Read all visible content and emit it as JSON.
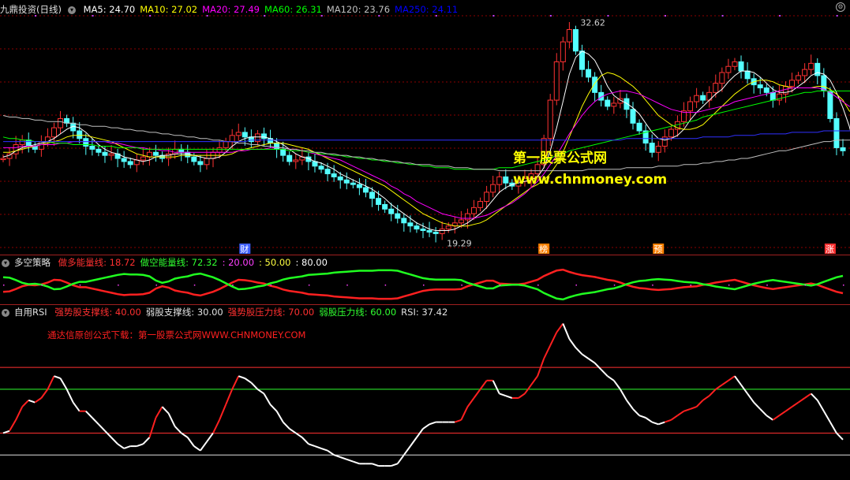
{
  "main": {
    "title": "九鼎投资(日线)",
    "ma": [
      {
        "label": "MA5: 24.70",
        "color": "#ffffff"
      },
      {
        "label": "MA10: 27.02",
        "color": "#ffff00"
      },
      {
        "label": "MA20: 27.49",
        "color": "#ff00ff"
      },
      {
        "label": "MA60: 26.31",
        "color": "#00ff00"
      },
      {
        "label": "MA120: 23.76",
        "color": "#c0c0c0"
      },
      {
        "label": "MA250: 24.11",
        "color": "#0000ff"
      }
    ],
    "high_label": "32.62",
    "low_label": "19.29",
    "watermark_cn": "第一股票公式网",
    "watermark_en": "www.chnmoney.com",
    "markers": [
      "财",
      "榜",
      "预",
      "涨"
    ]
  },
  "ind1": {
    "title": "多空策略",
    "labels": [
      {
        "text": "做多能量线: 18.72",
        "color": "#ff3030"
      },
      {
        "text": "做空能量线: 72.32",
        "color": "#30ff30"
      },
      {
        "text": ": 20.00",
        "color": "#ff40ff"
      },
      {
        "text": ": 50.00",
        "color": "#ffff40"
      },
      {
        "text": ": 80.00",
        "color": "#ffffff"
      }
    ]
  },
  "ind2": {
    "title": "自用RSI",
    "labels": [
      {
        "text": "强势股支撑线: 40.00",
        "color": "#ff3030"
      },
      {
        "text": "弱股支撑线: 30.00",
        "color": "#e0e0e0"
      },
      {
        "text": "强势股压力线: 70.00",
        "color": "#ff3030"
      },
      {
        "text": "弱股压力线: 60.00",
        "color": "#30ff30"
      },
      {
        "text": "RSI: 37.42",
        "color": "#e0e0e0"
      }
    ],
    "note": "通达信原创公式下载：第一股票公式网WWW.CHNMONEY.COM"
  },
  "colors": {
    "up": "#ff3232",
    "down": "#54ffff",
    "grid": "#8b0000"
  },
  "chart_data": {
    "type": "candlestick",
    "ylim": [
      18.5,
      33.5
    ],
    "price": [
      24.2,
      24.5,
      25.1,
      25.4,
      25.0,
      24.8,
      25.3,
      25.6,
      26.2,
      26.8,
      26.5,
      26.0,
      25.5,
      25.0,
      24.8,
      24.6,
      24.4,
      24.5,
      24.2,
      24.0,
      23.8,
      24.1,
      24.3,
      24.6,
      24.4,
      24.2,
      24.5,
      24.8,
      24.6,
      24.3,
      24.0,
      23.8,
      24.2,
      24.6,
      24.9,
      25.3,
      25.7,
      25.9,
      25.6,
      25.3,
      25.8,
      25.5,
      25.2,
      24.8,
      24.4,
      24.0,
      24.1,
      24.3,
      24.0,
      23.7,
      23.5,
      23.2,
      23.0,
      22.8,
      22.6,
      22.5,
      22.3,
      22.0,
      21.6,
      21.2,
      20.9,
      20.6,
      20.3,
      20.0,
      19.8,
      19.6,
      19.5,
      19.4,
      19.3,
      19.6,
      19.8,
      20.0,
      20.2,
      20.6,
      21.0,
      21.4,
      22.0,
      22.5,
      23.0,
      22.6,
      22.4,
      22.7,
      22.9,
      23.2,
      23.8,
      25.5,
      28.0,
      30.5,
      31.8,
      32.6,
      31.2,
      30.0,
      29.5,
      28.5,
      28.0,
      27.6,
      27.8,
      28.1,
      27.4,
      26.5,
      26.0,
      25.2,
      24.6,
      25.0,
      25.6,
      26.1,
      26.6,
      27.3,
      27.9,
      28.3,
      28.0,
      28.5,
      29.1,
      29.8,
      30.2,
      30.5,
      29.9,
      29.4,
      29.0,
      28.8,
      28.5,
      28.0,
      28.4,
      28.9,
      29.3,
      29.6,
      30.0,
      30.4,
      29.6,
      28.6,
      26.8,
      24.9,
      24.7
    ],
    "ma5": [
      24.3,
      24.4,
      24.7,
      24.9,
      25.0,
      25.1,
      25.2,
      25.3,
      25.5,
      25.8,
      26.1,
      26.3,
      26.2,
      25.9,
      25.5,
      25.1,
      24.8,
      24.6,
      24.5,
      24.3,
      24.2,
      24.1,
      24.0,
      24.1,
      24.3,
      24.4,
      24.4,
      24.5,
      24.5,
      24.5,
      24.4,
      24.3,
      24.2,
      24.2,
      24.3,
      24.6,
      25.0,
      25.3,
      25.5,
      25.6,
      25.6,
      25.6,
      25.5,
      25.3,
      25.1,
      24.8,
      24.5,
      24.3,
      24.2,
      24.0,
      23.9,
      23.7,
      23.5,
      23.2,
      23.0,
      22.8,
      22.6,
      22.4,
      22.2,
      21.9,
      21.6,
      21.2,
      20.9,
      20.6,
      20.3,
      20.0,
      19.8,
      19.6,
      19.5,
      19.5,
      19.5,
      19.6,
      19.8,
      20.0,
      20.3,
      20.6,
      21.0,
      21.5,
      22.0,
      22.3,
      22.5,
      22.6,
      22.7,
      22.8,
      23.0,
      23.6,
      24.7,
      26.2,
      27.9,
      29.7,
      30.8,
      31.2,
      31.0,
      30.6,
      29.8,
      28.9,
      28.3,
      28.0,
      27.8,
      27.5,
      27.1,
      26.5,
      25.9,
      25.5,
      25.4,
      25.5,
      25.7,
      26.1,
      26.7,
      27.2,
      27.6,
      28.0,
      28.4,
      28.7,
      29.2,
      29.6,
      29.9,
      29.9,
      29.8,
      29.5,
      29.1,
      28.7,
      28.5,
      28.5,
      28.6,
      28.9,
      29.2,
      29.6,
      29.8,
      29.7,
      29.3,
      28.5,
      27.5,
      26.3,
      24.7
    ],
    "ma10": [
      24.6,
      24.6,
      24.7,
      24.8,
      24.9,
      25.0,
      25.1,
      25.2,
      25.3,
      25.4,
      25.6,
      25.7,
      25.7,
      25.7,
      25.6,
      25.5,
      25.4,
      25.3,
      25.1,
      24.9,
      24.7,
      24.5,
      24.4,
      24.3,
      24.3,
      24.3,
      24.3,
      24.3,
      24.4,
      24.4,
      24.4,
      24.4,
      24.4,
      24.4,
      24.4,
      24.4,
      24.5,
      24.7,
      24.8,
      24.9,
      25.0,
      25.1,
      25.2,
      25.2,
      25.2,
      25.1,
      25.0,
      24.9,
      24.8,
      24.6,
      24.4,
      24.2,
      24.0,
      23.8,
      23.6,
      23.4,
      23.2,
      23.0,
      22.8,
      22.6,
      22.4,
      22.1,
      21.8,
      21.5,
      21.2,
      20.9,
      20.6,
      20.4,
      20.2,
      20.0,
      19.9,
      19.8,
      19.8,
      19.8,
      19.9,
      20.0,
      20.2,
      20.5,
      20.8,
      21.1,
      21.4,
      21.7,
      22.0,
      22.3,
      22.5,
      22.8,
      23.2,
      23.8,
      24.6,
      25.6,
      26.6,
      27.6,
      28.4,
      29.1,
      29.6,
      29.8,
      29.7,
      29.5,
      29.2,
      28.9,
      28.5,
      28.0,
      27.5,
      27.0,
      26.7,
      26.4,
      26.2,
      26.1,
      26.1,
      26.2,
      26.4,
      26.8,
      27.2,
      27.6,
      28.0,
      28.4,
      28.7,
      29.0,
      29.2,
      29.3,
      29.3,
      29.2,
      29.0,
      28.9,
      28.8,
      28.8,
      28.8,
      28.8,
      28.9,
      28.9,
      28.7,
      28.4,
      28.0,
      27.3,
      27.0
    ],
    "ma20": [
      24.9,
      24.9,
      24.9,
      25.0,
      25.0,
      25.0,
      25.1,
      25.1,
      25.1,
      25.2,
      25.2,
      25.3,
      25.3,
      25.3,
      25.3,
      25.3,
      25.3,
      25.2,
      25.2,
      25.1,
      25.0,
      24.9,
      24.9,
      24.8,
      24.8,
      24.7,
      24.7,
      24.6,
      24.6,
      24.6,
      24.6,
      24.6,
      24.6,
      24.6,
      24.6,
      24.6,
      24.6,
      24.7,
      24.7,
      24.8,
      24.8,
      24.8,
      24.9,
      24.9,
      24.9,
      24.8,
      24.8,
      24.7,
      24.6,
      24.5,
      24.4,
      24.3,
      24.2,
      24.1,
      23.9,
      23.7,
      23.5,
      23.3,
      23.1,
      22.9,
      22.7,
      22.4,
      22.2,
      21.9,
      21.7,
      21.4,
      21.2,
      21.0,
      20.8,
      20.6,
      20.5,
      20.4,
      20.3,
      20.3,
      20.3,
      20.4,
      20.5,
      20.7,
      20.9,
      21.1,
      21.3,
      21.6,
      21.9,
      22.3,
      22.7,
      23.2,
      23.8,
      24.4,
      25.1,
      25.8,
      26.4,
      27.0,
      27.5,
      27.9,
      28.2,
      28.4,
      28.5,
      28.6,
      28.6,
      28.5,
      28.4,
      28.2,
      28.0,
      27.8,
      27.6,
      27.4,
      27.3,
      27.2,
      27.2,
      27.2,
      27.3,
      27.4,
      27.5,
      27.6,
      27.7,
      27.9,
      28.0,
      28.1,
      28.2,
      28.3,
      28.4,
      28.5,
      28.6,
      28.7,
      28.8,
      28.8,
      28.8,
      28.8,
      28.8,
      28.7,
      28.5,
      28.2,
      27.9,
      27.6,
      27.5
    ],
    "ma60": [
      25.6,
      25.5,
      25.5,
      25.4,
      25.4,
      25.3,
      25.3,
      25.3,
      25.2,
      25.2,
      25.2,
      25.1,
      25.1,
      25.1,
      25.1,
      25.0,
      25.0,
      25.0,
      24.9,
      24.9,
      24.9,
      24.9,
      24.8,
      24.8,
      24.8,
      24.8,
      24.8,
      24.8,
      24.8,
      24.8,
      24.8,
      24.8,
      24.8,
      24.8,
      24.8,
      24.8,
      24.8,
      24.8,
      24.8,
      24.8,
      24.8,
      24.8,
      24.8,
      24.8,
      24.8,
      24.7,
      24.7,
      24.7,
      24.6,
      24.6,
      24.5,
      24.5,
      24.4,
      24.4,
      24.3,
      24.3,
      24.2,
      24.2,
      24.1,
      24.1,
      24.0,
      24.0,
      23.9,
      23.9,
      23.8,
      23.8,
      23.7,
      23.7,
      23.6,
      23.6,
      23.6,
      23.5,
      23.5,
      23.5,
      23.5,
      23.5,
      23.5,
      23.5,
      23.6,
      23.6,
      23.6,
      23.7,
      23.8,
      23.9,
      24.0,
      24.1,
      24.2,
      24.4,
      24.5,
      24.7,
      24.8,
      24.9,
      25.0,
      25.1,
      25.2,
      25.3,
      25.4,
      25.5,
      25.6,
      25.7,
      25.8,
      25.9,
      26.0,
      26.1,
      26.2,
      26.3,
      26.4,
      26.5,
      26.6,
      26.7,
      26.9,
      27.0,
      27.1,
      27.2,
      27.3,
      27.4,
      27.5,
      27.6,
      27.7,
      27.8,
      27.9,
      28.0,
      28.1,
      28.2,
      28.3,
      28.4,
      28.5,
      28.5,
      28.6,
      28.6,
      28.6,
      28.6,
      28.6,
      28.6,
      28.6
    ],
    "ma120": [
      27.0,
      26.9,
      26.9,
      26.8,
      26.8,
      26.7,
      26.7,
      26.6,
      26.6,
      26.6,
      26.5,
      26.5,
      26.4,
      26.4,
      26.3,
      26.3,
      26.3,
      26.2,
      26.2,
      26.1,
      26.1,
      26.0,
      26.0,
      25.9,
      25.9,
      25.8,
      25.8,
      25.7,
      25.7,
      25.6,
      25.6,
      25.5,
      25.5,
      25.4,
      25.4,
      25.3,
      25.3,
      25.2,
      25.2,
      25.1,
      25.1,
      25.0,
      25.0,
      24.9,
      24.9,
      24.8,
      24.8,
      24.7,
      24.7,
      24.6,
      24.6,
      24.5,
      24.5,
      24.4,
      24.4,
      24.3,
      24.3,
      24.2,
      24.2,
      24.1,
      24.1,
      24.0,
      24.0,
      23.9,
      23.9,
      23.8,
      23.8,
      23.8,
      23.7,
      23.7,
      23.7,
      23.6,
      23.6,
      23.6,
      23.5,
      23.5,
      23.5,
      23.5,
      23.4,
      23.4,
      23.4,
      23.4,
      23.4,
      23.4,
      23.4,
      23.4,
      23.4,
      23.4,
      23.4,
      23.4,
      23.4,
      23.4,
      23.5,
      23.5,
      23.5,
      23.5,
      23.5,
      23.5,
      23.6,
      23.6,
      23.6,
      23.6,
      23.6,
      23.7,
      23.7,
      23.7,
      23.7,
      23.8,
      23.8,
      23.8,
      23.9,
      23.9,
      24.0,
      24.0,
      24.1,
      24.1,
      24.2,
      24.2,
      24.3,
      24.4,
      24.5,
      24.6,
      24.7,
      24.7,
      24.8,
      24.9,
      25.0,
      25.1,
      25.2,
      25.3,
      25.3,
      25.4,
      25.4,
      25.4,
      25.4
    ],
    "ma250": [
      25.3,
      25.3,
      25.3,
      25.3,
      25.3,
      25.3,
      25.3,
      25.3,
      25.3,
      25.3,
      25.3,
      25.3,
      25.3,
      25.3,
      25.3,
      25.3,
      25.3,
      25.3,
      25.3,
      25.3,
      25.3,
      25.3,
      25.3,
      25.3,
      25.3,
      25.3,
      25.3,
      25.3,
      25.3,
      25.3,
      25.3,
      25.3,
      25.3,
      25.3,
      25.3,
      25.3,
      25.3,
      25.3,
      25.3,
      25.4,
      25.4,
      25.4,
      25.4,
      25.4,
      25.4,
      25.4,
      25.4,
      25.4,
      25.4,
      25.4,
      25.4,
      25.4,
      25.4,
      25.4,
      25.4,
      25.4,
      25.4,
      25.4,
      25.4,
      25.4,
      25.4,
      25.4,
      25.4,
      25.4,
      25.4,
      25.4,
      25.4,
      25.4,
      25.4,
      25.4,
      25.4,
      25.4,
      25.4,
      25.4,
      25.4,
      25.4,
      25.4,
      25.4,
      25.4,
      25.4,
      25.4,
      25.4,
      25.4,
      25.4,
      25.4,
      25.4,
      25.4,
      25.4,
      25.4,
      25.4,
      25.4,
      25.4,
      25.4,
      25.4,
      25.4,
      25.4,
      25.4,
      25.4,
      25.5,
      25.5,
      25.5,
      25.5,
      25.5,
      25.5,
      25.5,
      25.5,
      25.5,
      25.5,
      25.5,
      25.5,
      25.6,
      25.6,
      25.6,
      25.6,
      25.6,
      25.7,
      25.7,
      25.7,
      25.7,
      25.8,
      25.8,
      25.8,
      25.8,
      25.8,
      25.9,
      25.9,
      25.9,
      25.9,
      25.9,
      26.0,
      26.0,
      26.0,
      26.0,
      26.0,
      26.0
    ],
    "rsi": [
      40,
      41,
      46,
      52,
      55,
      54,
      56,
      60,
      66,
      65,
      60,
      54,
      50,
      50,
      47,
      44,
      41,
      38,
      35,
      33,
      34,
      34,
      35,
      38,
      47,
      52,
      49,
      43,
      40,
      38,
      34,
      32,
      36,
      40,
      46,
      53,
      60,
      66,
      65,
      63,
      60,
      58,
      53,
      50,
      45,
      42,
      40,
      38,
      35,
      34,
      33,
      32,
      30,
      29,
      28,
      27,
      26,
      26,
      26,
      25,
      25,
      25,
      26,
      30,
      34,
      38,
      42,
      44,
      45,
      45,
      45,
      45,
      46,
      52,
      56,
      60,
      64,
      64,
      58,
      57,
      56,
      56,
      58,
      62,
      66,
      74,
      80,
      86,
      90,
      83,
      79,
      76,
      74,
      72,
      69,
      66,
      64,
      60,
      55,
      51,
      48,
      47,
      45,
      44,
      45,
      46,
      48,
      50,
      51,
      52,
      55,
      57,
      60,
      62,
      64,
      66,
      62,
      58,
      54,
      51,
      48,
      46,
      48,
      50,
      52,
      54,
      56,
      58,
      55,
      50,
      45,
      40,
      37
    ]
  }
}
